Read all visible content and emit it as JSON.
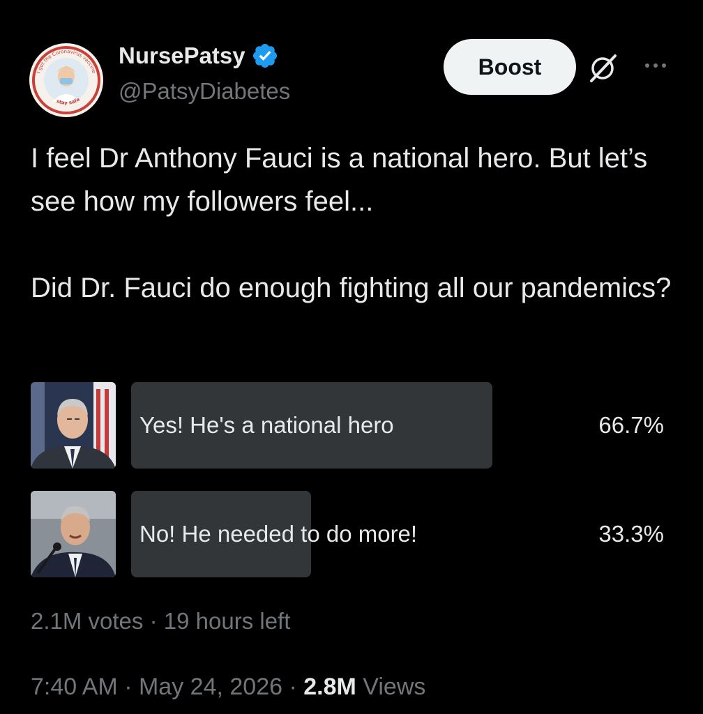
{
  "author": {
    "display_name": "NursePatsy",
    "handle": "@PatsyDiabetes",
    "verified": true,
    "avatar_ring_text_top": "I got the Coronavirus vaccine",
    "avatar_ring_text_bottom": "stay safe"
  },
  "header": {
    "boost_label": "Boost",
    "grok_icon": "grok-icon",
    "more_icon": "more-icon"
  },
  "tweet": {
    "paragraph_1": "I feel Dr Anthony Fauci is a national hero. But let’s see how my followers feel...",
    "paragraph_2": "Did Dr. Fauci do enough fighting all our pandemics?"
  },
  "poll": {
    "options": [
      {
        "label": "Yes! He's a national hero",
        "percent": "66.7%",
        "fraction": 0.667
      },
      {
        "label": "No! He needed to do more!",
        "percent": "33.3%",
        "fraction": 0.333
      }
    ],
    "votes": "2.1M votes",
    "time_left": "19 hours left"
  },
  "meta": {
    "time": "7:40 AM",
    "date": "May 24, 2026",
    "views_count": "2.8M",
    "views_label": "Views"
  },
  "colors": {
    "background": "#000000",
    "primary_text": "#e7e9ea",
    "secondary_text": "#71767b",
    "verified_badge": "#1d9bf0",
    "poll_bar": "#333639",
    "boost_button": "#eff3f4"
  }
}
